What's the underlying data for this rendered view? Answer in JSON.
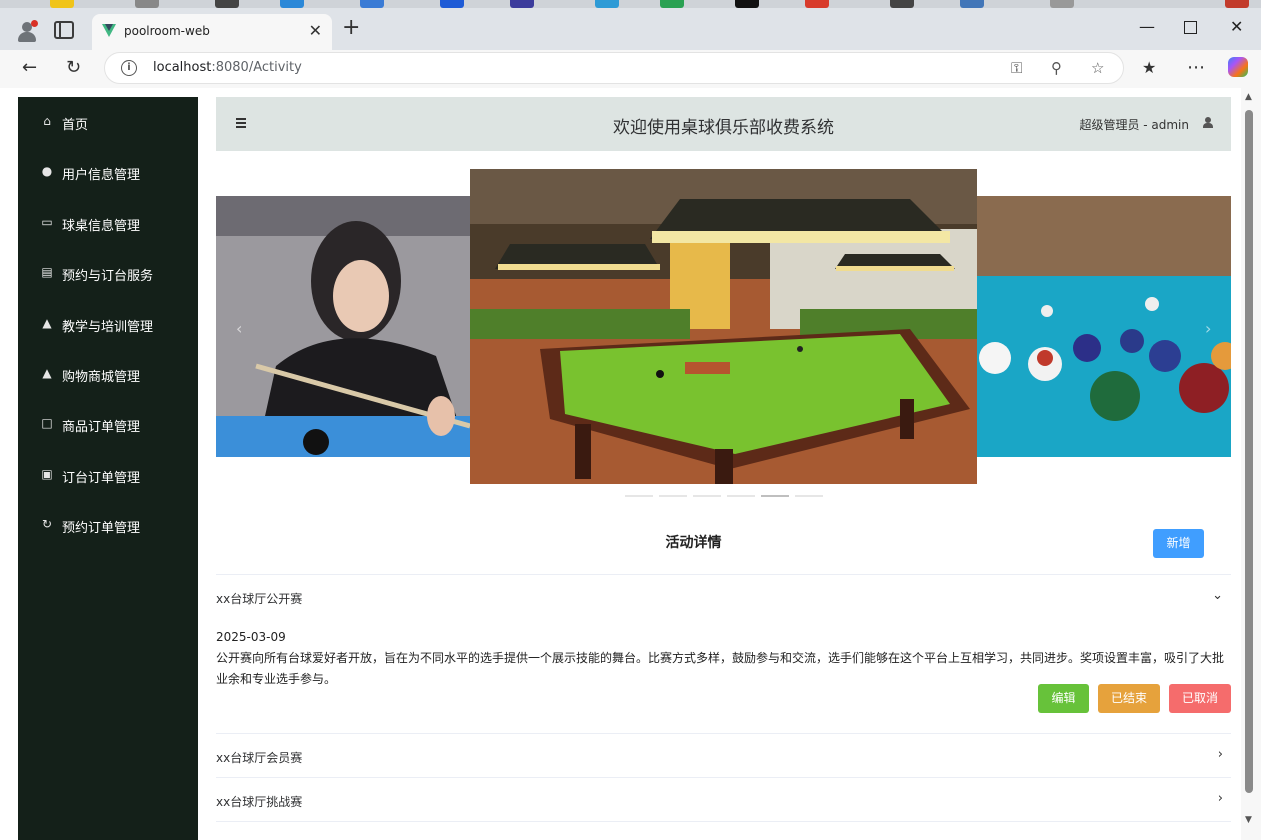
{
  "browser": {
    "tab_title": "poolroom-web",
    "url_host": "localhost",
    "url_rest": ":8080/Activity",
    "new_tab_symbol": "+",
    "close_symbol": "✕"
  },
  "sidebar": {
    "items": [
      {
        "label": "首页",
        "icon": "home-icon"
      },
      {
        "label": "用户信息管理",
        "icon": "user-icon"
      },
      {
        "label": "球桌信息管理",
        "icon": "monitor-icon"
      },
      {
        "label": "预约与订台服务",
        "icon": "clipboard-icon"
      },
      {
        "label": "教学与培训管理",
        "icon": "person-icon"
      },
      {
        "label": "购物商城管理",
        "icon": "shop-icon"
      },
      {
        "label": "商品订单管理",
        "icon": "bag-icon"
      },
      {
        "label": "订台订单管理",
        "icon": "order-icon"
      },
      {
        "label": "预约订单管理",
        "icon": "refresh-icon"
      }
    ]
  },
  "header": {
    "title": "欢迎使用桌球俱乐部收费系统",
    "user": "超级管理员 - admin"
  },
  "activity": {
    "section_title": "活动详情",
    "add_label": "新增",
    "items": [
      {
        "name": "xx台球厅公开赛",
        "date": "2025-03-09",
        "desc": "公开赛向所有台球爱好者开放，旨在为不同水平的选手提供一个展示技能的舞台。比赛方式多样，鼓励参与和交流，选手们能够在这个平台上互相学习，共同进步。奖项设置丰富，吸引了大批业余和专业选手参与。",
        "edit_label": "编辑",
        "finish_label": "已结束",
        "cancel_label": "已取消"
      },
      {
        "name": "xx台球厅会员赛"
      },
      {
        "name": "xx台球厅挑战赛"
      }
    ]
  },
  "colors": {
    "sidebar_bg": "#142019",
    "header_bg": "#dde4e2",
    "primary": "#409eff",
    "success": "#67c23a",
    "warning": "#e6a23c",
    "danger": "#f56c6c"
  },
  "carousel": {
    "slide_count": 6,
    "active_index": 4
  }
}
